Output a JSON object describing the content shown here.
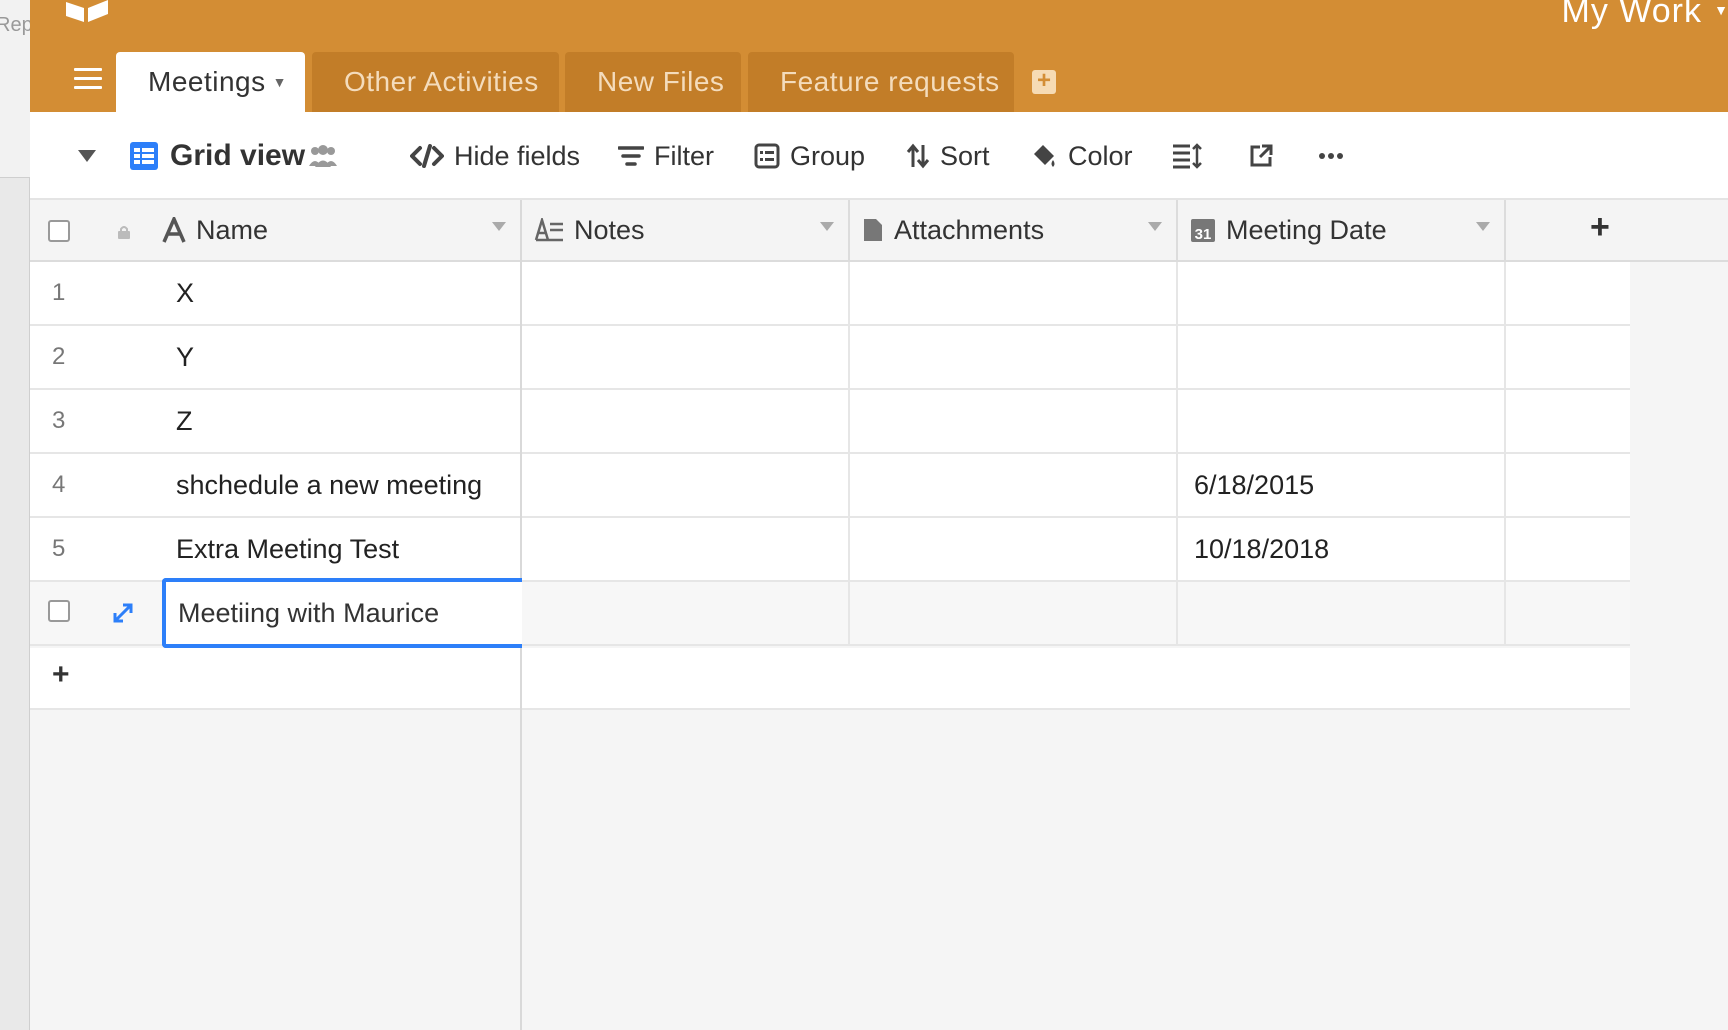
{
  "background_window": {
    "peek_text": "Rep"
  },
  "header": {
    "workspace_name": "My Work",
    "tabs": [
      {
        "label": "Meetings",
        "active": true
      },
      {
        "label": "Other Activities",
        "active": false
      },
      {
        "label": "New Files",
        "active": false
      },
      {
        "label": "Feature requests",
        "active": false
      }
    ]
  },
  "toolbar": {
    "view_name": "Grid view",
    "hide_fields": "Hide fields",
    "filter": "Filter",
    "group": "Group",
    "sort": "Sort",
    "color": "Color"
  },
  "grid": {
    "columns": [
      {
        "label": "Name",
        "icon": "text-type-icon"
      },
      {
        "label": "Notes",
        "icon": "long-text-icon"
      },
      {
        "label": "Attachments",
        "icon": "file-icon"
      },
      {
        "label": "Meeting Date",
        "icon": "calendar-icon",
        "icon_text": "31"
      }
    ],
    "rows": [
      {
        "num": "1",
        "name": "X",
        "notes": "",
        "attachments": "",
        "date": ""
      },
      {
        "num": "2",
        "name": "Y",
        "notes": "",
        "attachments": "",
        "date": ""
      },
      {
        "num": "3",
        "name": "Z",
        "notes": "",
        "attachments": "",
        "date": ""
      },
      {
        "num": "4",
        "name": "shchedule a new meeting",
        "notes": "",
        "attachments": "",
        "date": "6/18/2015"
      },
      {
        "num": "5",
        "name": "Extra Meeting Test",
        "notes": "",
        "attachments": "",
        "date": "10/18/2018"
      }
    ],
    "editing_row": {
      "name": "Meetiing with Maurice"
    }
  },
  "colors": {
    "header": "#d38d34",
    "accent": "#2d7ff9"
  }
}
